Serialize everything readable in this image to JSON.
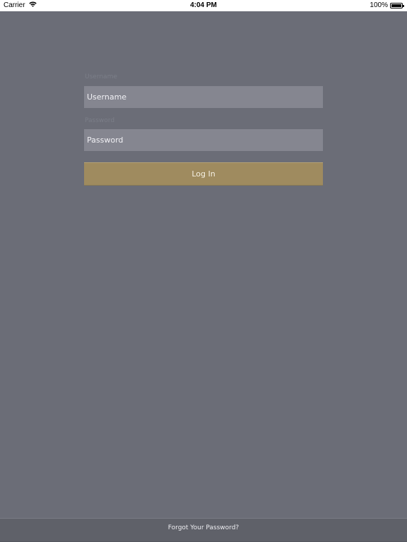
{
  "status_bar": {
    "carrier": "Carrier",
    "time": "4:04 PM",
    "battery": "100%",
    "battery_level": 1.0
  },
  "login": {
    "username_label": "Username",
    "username_placeholder": "Username",
    "username_value": "",
    "password_label": "Password",
    "password_placeholder": "Password",
    "password_value": "",
    "login_label": "Log In"
  },
  "footer": {
    "forgot_password": "Forgot Your Password?"
  },
  "icons": {
    "wifi": "wifi-icon",
    "battery": "battery-icon"
  },
  "colors": {
    "background": "#6b6d77",
    "input": "#858690",
    "button": "#9f8b5f",
    "footer": "#5f6169"
  }
}
